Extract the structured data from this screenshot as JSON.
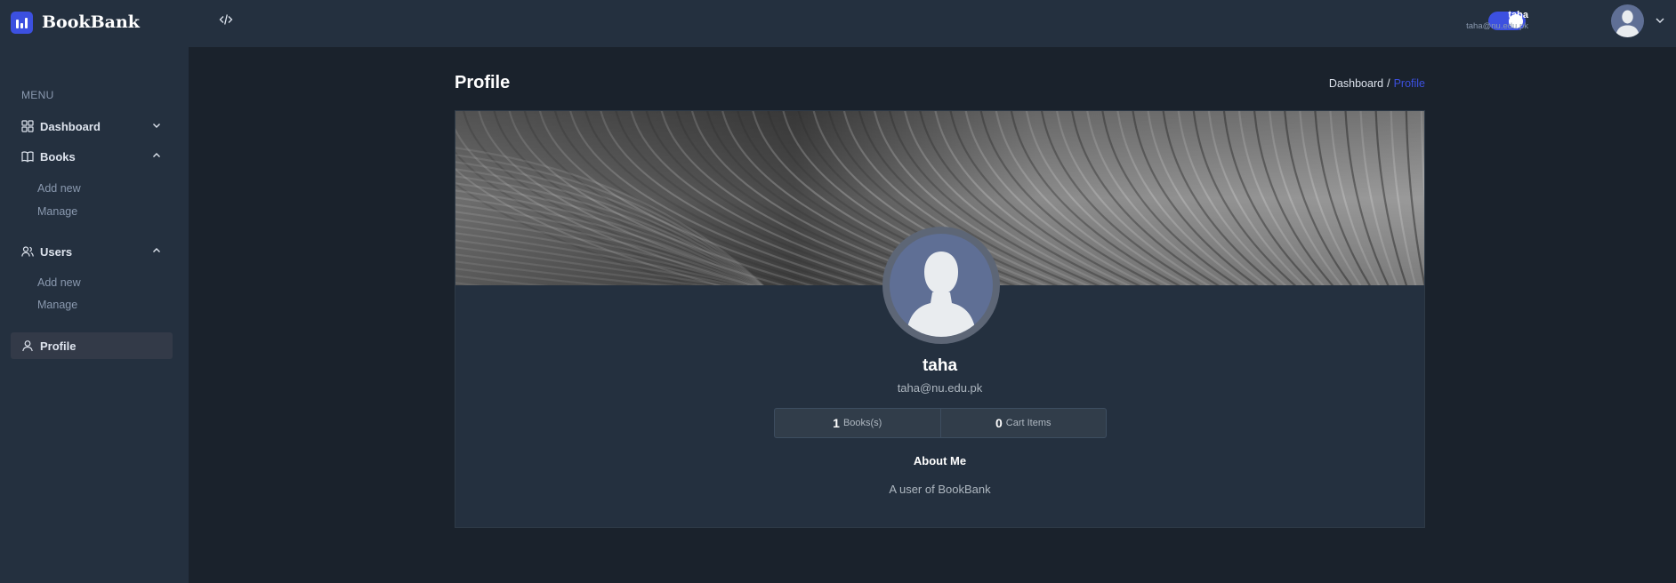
{
  "app": {
    "name": "BookBank",
    "accent": "#3c50e0"
  },
  "sidebar": {
    "menu_title": "MENU",
    "items": [
      {
        "label": "Dashboard",
        "icon": "grid-icon",
        "expanded": false
      },
      {
        "label": "Books",
        "icon": "book-icon",
        "expanded": true,
        "children": [
          {
            "label": "Add new"
          },
          {
            "label": "Manage"
          }
        ]
      },
      {
        "label": "Users",
        "icon": "users-icon",
        "expanded": true,
        "children": [
          {
            "label": "Add new"
          },
          {
            "label": "Manage"
          }
        ]
      },
      {
        "label": "Profile",
        "icon": "user-icon",
        "active": true
      }
    ]
  },
  "header": {
    "dark_mode": true,
    "user": {
      "name": "taha",
      "email": "taha@nu.edu.pk"
    }
  },
  "page": {
    "title": "Profile",
    "breadcrumb": {
      "parent": "Dashboard",
      "separator": "/",
      "current": "Profile"
    }
  },
  "profile": {
    "name": "taha",
    "email": "taha@nu.edu.pk",
    "stats": [
      {
        "value": "1",
        "label": "Books(s)"
      },
      {
        "value": "0",
        "label": "Cart Items"
      }
    ],
    "about_title": "About Me",
    "about_text": "A user of BookBank"
  }
}
